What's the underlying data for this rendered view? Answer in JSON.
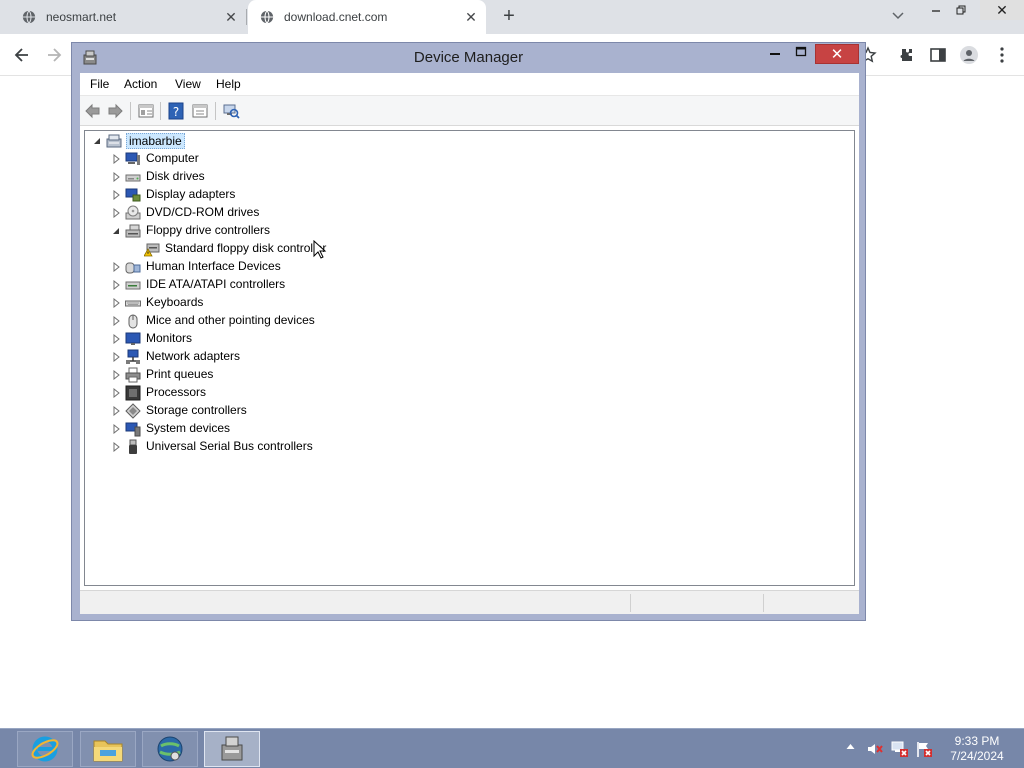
{
  "browser": {
    "tabs": [
      {
        "label": "neosmart.net",
        "active": false
      },
      {
        "label": "download.cnet.com",
        "active": true
      }
    ],
    "new_tab_symbol": "+",
    "close_symbol": "✕"
  },
  "device_manager": {
    "title": "Device Manager",
    "menu": [
      "File",
      "Action",
      "View",
      "Help"
    ],
    "root": {
      "label": "imabarbie",
      "expanded": true
    },
    "tree": [
      {
        "label": "Computer",
        "icon": "computer-icon",
        "expanded": false
      },
      {
        "label": "Disk drives",
        "icon": "disk-drive-icon",
        "expanded": false
      },
      {
        "label": "Display adapters",
        "icon": "display-adapter-icon",
        "expanded": false
      },
      {
        "label": "DVD/CD-ROM drives",
        "icon": "dvd-drive-icon",
        "expanded": false
      },
      {
        "label": "Floppy drive controllers",
        "icon": "floppy-controller-icon",
        "expanded": true,
        "children": [
          {
            "label": "Standard floppy disk controller",
            "icon": "floppy-controller-warning-icon"
          }
        ]
      },
      {
        "label": "Human Interface Devices",
        "icon": "hid-icon",
        "expanded": false
      },
      {
        "label": "IDE ATA/ATAPI controllers",
        "icon": "ide-controller-icon",
        "expanded": false
      },
      {
        "label": "Keyboards",
        "icon": "keyboard-icon",
        "expanded": false
      },
      {
        "label": "Mice and other pointing devices",
        "icon": "mouse-icon",
        "expanded": false
      },
      {
        "label": "Monitors",
        "icon": "monitor-icon",
        "expanded": false
      },
      {
        "label": "Network adapters",
        "icon": "network-adapter-icon",
        "expanded": false
      },
      {
        "label": "Print queues",
        "icon": "printer-icon",
        "expanded": false
      },
      {
        "label": "Processors",
        "icon": "processor-icon",
        "expanded": false
      },
      {
        "label": "Storage controllers",
        "icon": "storage-controller-icon",
        "expanded": false
      },
      {
        "label": "System devices",
        "icon": "system-devices-icon",
        "expanded": false
      },
      {
        "label": "Universal Serial Bus controllers",
        "icon": "usb-icon",
        "expanded": false
      }
    ]
  },
  "taskbar": {
    "apps": [
      "internet-explorer-icon",
      "file-explorer-icon",
      "network-globe-icon",
      "device-manager-icon"
    ],
    "clock": {
      "time": "9:33 PM",
      "date": "7/24/2024"
    }
  },
  "colors": {
    "window_frame": "#a9b2cf",
    "close_button": "#c74343",
    "taskbar": "#7787a9",
    "selection": "#cce8ff"
  }
}
